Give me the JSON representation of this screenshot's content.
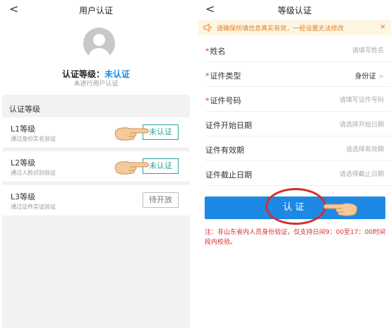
{
  "left": {
    "back_glyph": "<",
    "title": "用户认证",
    "profile": {
      "level_label": "认证等级：",
      "level_value": "未认证",
      "subtitle": "未进行用户认证"
    },
    "section_title": "认证等级",
    "levels": [
      {
        "title": "L1等级",
        "desc": "通过身份实名验证",
        "button": "未认证",
        "enabled": true
      },
      {
        "title": "L2等级",
        "desc": "通过人脸识别验证",
        "button": "未认证",
        "enabled": true
      },
      {
        "title": "L3等级",
        "desc": "通过证件实证验证",
        "button": "待开放",
        "enabled": false
      }
    ]
  },
  "right": {
    "back_glyph": "<",
    "title": "等级认证",
    "notice": {
      "icon": "speaker-icon",
      "text": "请确保所填信息真实有效，一经设置无法修改",
      "close": "×"
    },
    "fields": [
      {
        "label": "姓名",
        "required": true,
        "placeholder": "请填写姓名",
        "value": ""
      },
      {
        "label": "证件类型",
        "required": true,
        "placeholder": "",
        "value": "身份证",
        "chevron": ">"
      },
      {
        "label": "证件号码",
        "required": true,
        "placeholder": "请填写证件号码",
        "value": ""
      },
      {
        "label": "证件开始日期",
        "required": false,
        "placeholder": "请选择开始日期",
        "value": ""
      },
      {
        "label": "证件有效期",
        "required": false,
        "placeholder": "请选择有效期",
        "value": ""
      },
      {
        "label": "证件截止日期",
        "required": false,
        "placeholder": "请选择截止日期",
        "value": ""
      }
    ],
    "submit_label": "认证",
    "note": "注：非山东省内人员身份验证，仅支持日间9：00至17：00时间段内校验。"
  },
  "colors": {
    "accent": "#1e88e5",
    "verify_border": "#26a69a",
    "warning": "#e67e22",
    "highlight_circle": "#d32f2f"
  }
}
